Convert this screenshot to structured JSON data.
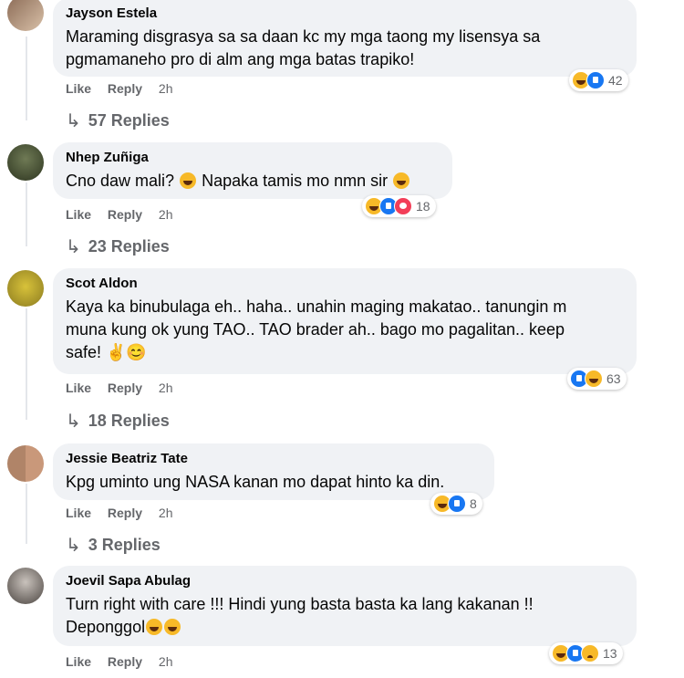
{
  "labels": {
    "like": "Like",
    "reply": "Reply",
    "arrow": "↳"
  },
  "comments": [
    {
      "author": "Jayson Estela",
      "text": "Maraming disgrasya sa sa daan kc my mga taong my lisensya sa\npgmamaneho pro di alm ang mga batas trapiko!",
      "time": "2h",
      "reactions": [
        "haha",
        "like"
      ],
      "reaction_count": "42",
      "replies": "57 Replies"
    },
    {
      "author": "Nhep Zuñiga",
      "text": "Cno daw mali?",
      "text2": "Napaka tamis mo nmn sir",
      "time": "2h",
      "reactions": [
        "haha",
        "like",
        "love"
      ],
      "reaction_count": "18",
      "replies": "23 Replies"
    },
    {
      "author": "Scot Aldon",
      "text": "Kaya ka binubulaga eh.. haha.. unahin maging makatao.. tanungin m\nmuna kung ok yung TAO.. TAO brader ah.. bago mo pagalitan.. keep\nsafe! ✌️😊",
      "time": "2h",
      "reactions": [
        "like",
        "haha"
      ],
      "reaction_count": "63",
      "replies": "18 Replies"
    },
    {
      "author": "Jessie Beatriz Tate",
      "text": "Kpg uminto ung NASA kanan mo dapat hinto ka din.",
      "time": "2h",
      "reactions": [
        "haha",
        "like"
      ],
      "reaction_count": "8",
      "replies": "3 Replies"
    },
    {
      "author": "Joevil Sapa Abulag",
      "text": "Turn right with care !!! Hindi yung basta basta ka lang kakanan !!\nDeponggol",
      "time": "2h",
      "reactions": [
        "haha",
        "like",
        "sad"
      ],
      "reaction_count": "13"
    }
  ]
}
